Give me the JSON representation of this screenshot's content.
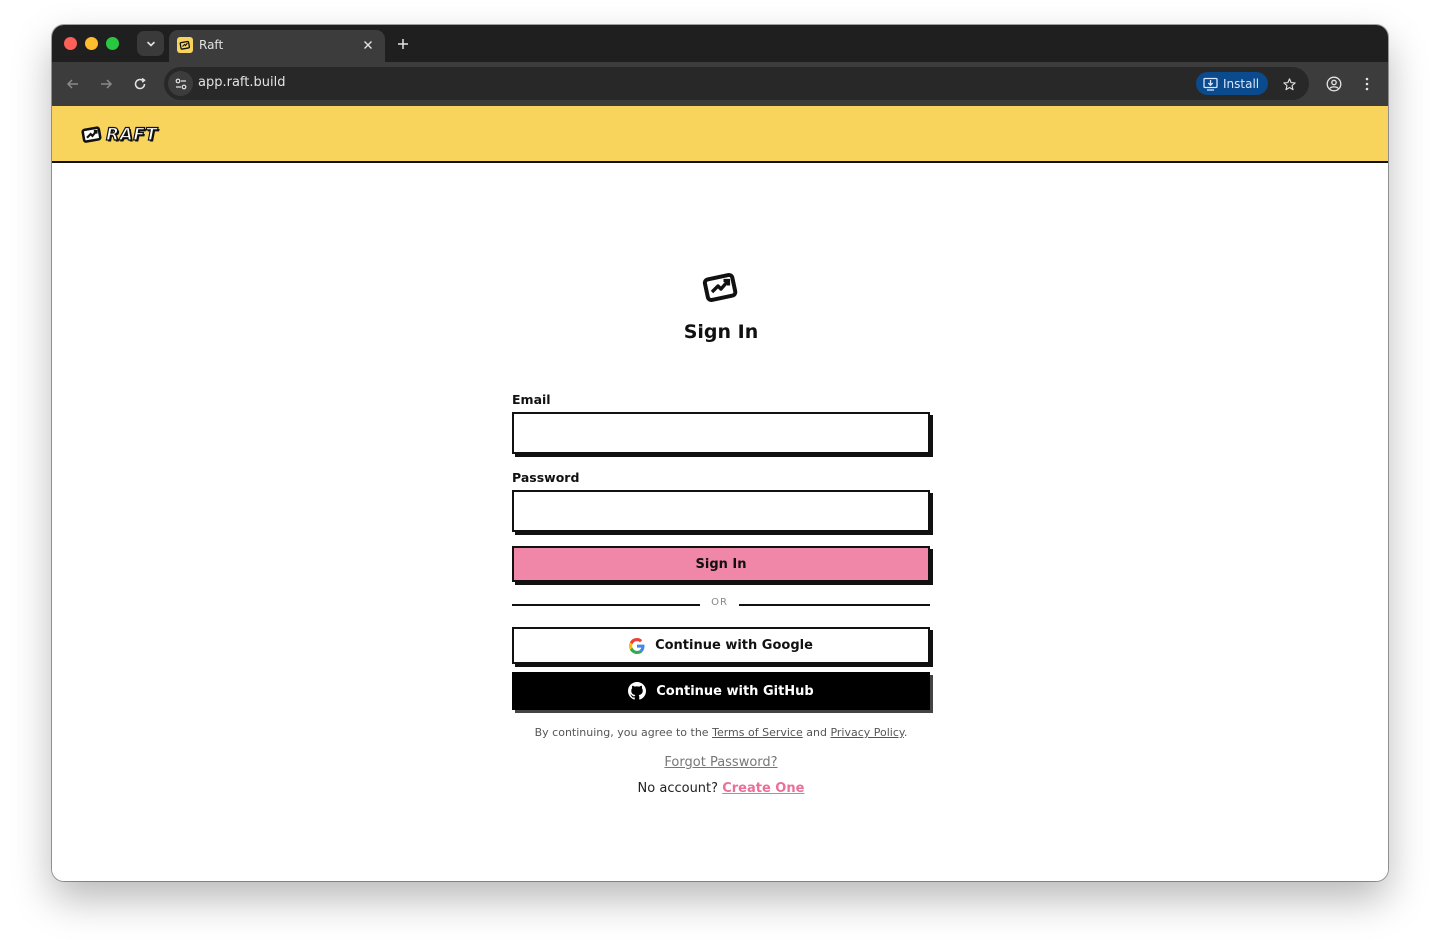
{
  "browser": {
    "tab_title": "Raft",
    "url": "app.raft.build",
    "install_label": "Install"
  },
  "app": {
    "brand": "RAFT",
    "colors": {
      "header_bg": "#f8d45c",
      "primary_button": "#f086a8",
      "link_accent": "#ec6f9a"
    }
  },
  "signin": {
    "title": "Sign In",
    "email_label": "Email",
    "email_value": "",
    "password_label": "Password",
    "password_value": "",
    "submit_label": "Sign In",
    "divider_text": "OR",
    "google_label": "Continue with Google",
    "github_label": "Continue with GitHub",
    "terms_prefix": "By continuing, you agree to the",
    "terms_link": "Terms of Service",
    "terms_and": "and",
    "privacy_link": "Privacy Policy",
    "terms_suffix": ".",
    "forgot_label": "Forgot Password?",
    "no_account_text": "No account?",
    "create_label": "Create One"
  }
}
